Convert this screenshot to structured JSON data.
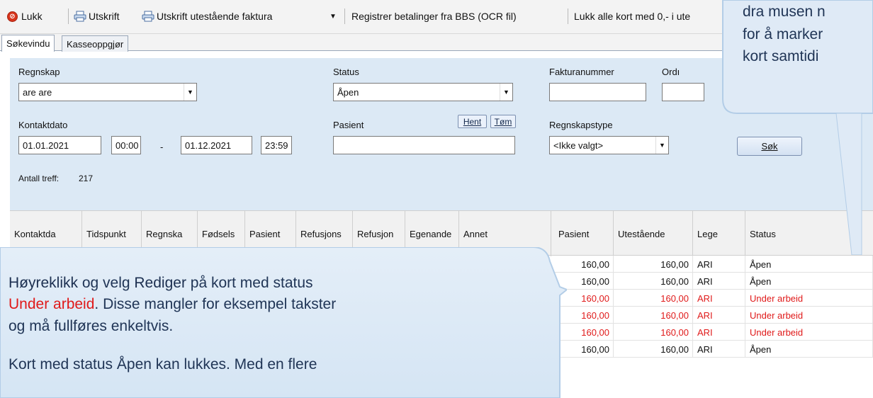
{
  "toolbar": {
    "close": "Lukk",
    "print": "Utskrift",
    "print_outstanding": "Utskrift utestående faktura",
    "register_bbs": "Registrer betalinger fra BBS (OCR fil)",
    "close_all": "Lukk alle kort med 0,- i ute"
  },
  "tabs": [
    "Søkevindu",
    "Kasseoppgjør"
  ],
  "search": {
    "regnskap_label": "Regnskap",
    "regnskap_value": "are are",
    "status_label": "Status",
    "status_value": "Åpen",
    "fakturanummer_label": "Fakturanummer",
    "fakturanummer_value": "",
    "ordre_label": "Ordı",
    "kontaktdato_label": "Kontaktdato",
    "date_from": "01.01.2021",
    "time_from": "00:00",
    "dash": "-",
    "date_to": "01.12.2021",
    "time_to": "23:59",
    "pasient_label": "Pasient",
    "hent_label": "Hent",
    "tom_label": "Tøm",
    "pasient_value": "",
    "regnskapstype_label": "Regnskapstype",
    "regnskapstype_value": "<Ikke valgt>",
    "sok_label": "Søk",
    "antall_label": "Antall treff:",
    "antall_value": "217"
  },
  "grid": {
    "columns": [
      "Kontaktda",
      "Tidspunkt",
      "Regnska",
      "Fødsels",
      "Pasient",
      "Refusjons",
      "Refusjon",
      "Egenande",
      "Annet",
      "Pasient",
      "Utestående",
      "Lege",
      "Status"
    ],
    "rows": [
      {
        "pasient": "160,00",
        "utestaende": "160,00",
        "lege": "ARI",
        "status": "Åpen",
        "red": false
      },
      {
        "pasient": "160,00",
        "utestaende": "160,00",
        "lege": "ARI",
        "status": "Åpen",
        "red": false
      },
      {
        "pasient": "160,00",
        "utestaende": "160,00",
        "lege": "ARI",
        "status": "Under arbeid",
        "red": true
      },
      {
        "pasient": "160,00",
        "utestaende": "160,00",
        "lege": "ARI",
        "status": "Under arbeid",
        "red": true
      },
      {
        "pasient": "160,00",
        "utestaende": "160,00",
        "lege": "ARI",
        "status": "Under arbeid",
        "red": true
      },
      {
        "pasient": "160,00",
        "utestaende": "160,00",
        "lege": "ARI",
        "status": "Åpen",
        "red": false
      }
    ]
  },
  "callout_left": {
    "w1": "Høyreklikk",
    "w2": " og velg ",
    "w3": "Rediger",
    "w4": " på kort med status",
    "w5": "Under arbeid",
    "w6": ". Disse mangler for eksempel takster",
    "w7": "og må fullføres enkeltvis.",
    "line3": "Kort med status Åpen kan lukkes. Med en flere"
  },
  "callout_right": {
    "line1": "dra musen n",
    "line2": "for å marker",
    "line3": "kort samtidi"
  }
}
